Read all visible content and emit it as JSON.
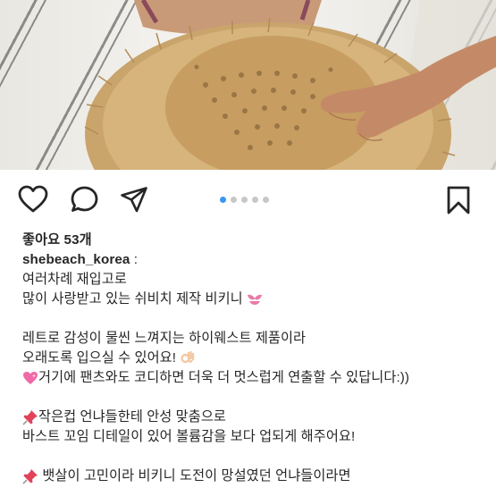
{
  "post": {
    "photo_description_icon": "beach-hat-photo",
    "carousel": {
      "count": 5,
      "active_index": 0,
      "active_color": "#3897f0",
      "inactive_color": "#c7c7c7"
    },
    "actions": {
      "like_icon": "heart-icon",
      "comment_icon": "comment-icon",
      "share_icon": "paper-plane-icon",
      "save_icon": "bookmark-icon"
    },
    "likes_text": "좋아요 53개",
    "username": "shebeach_korea",
    "username_suffix": " :",
    "caption_lines": [
      {
        "text": "여러차례 재입고로"
      },
      {
        "text": "많이 사랑받고 있는 쉬비치 제작 비키니 ",
        "emoji": "bikini-icon"
      },
      {
        "text": ""
      },
      {
        "text": "레트로 감성이 물씬 느껴지는 하이웨스트 제품이라"
      },
      {
        "text": "오래도록 입으실 수 있어요! ",
        "emoji": "ok-hand-icon"
      },
      {
        "prefix_emoji": "sparkling-heart-icon",
        "text": "거기에 팬츠와도 코디하면 더욱 더 멋스럽게 연출할 수 있답니다:))"
      },
      {
        "text": ""
      },
      {
        "prefix_emoji": "pushpin-icon",
        "text": "작은컵 언냐들한테 안성 맞춤으로"
      },
      {
        "text": "바스트 꼬임 디테일이 있어 볼륨감을 보다 업되게 해주어요!"
      },
      {
        "text": ""
      },
      {
        "prefix_emoji": "pushpin-icon",
        "text": " 뱃살이 고민이라 비키니 도전이 망설였던 언냐들이라면"
      }
    ]
  }
}
